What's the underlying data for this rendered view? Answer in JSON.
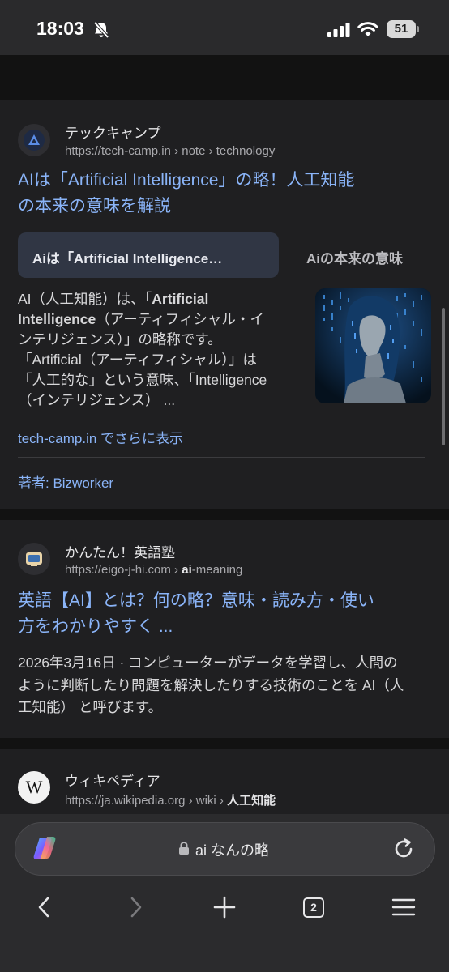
{
  "status": {
    "time": "18:03",
    "battery": "51"
  },
  "results": [
    {
      "site_name": "テックキャンプ",
      "url_base": "https://tech-camp.in",
      "url_path": " › note › technology",
      "title_line1": "AIは「Artificial Intelligence」の略！人工知能",
      "title_line2": "の本来の意味を解説",
      "chips": [
        "Aiは「Artificial Intelligence…",
        "Aiの本来の意味"
      ],
      "snippet": {
        "l1_a": "AI（人工知能）は、「",
        "l1_b": "Artificial",
        "l2_a": "Intelligence",
        "l2_b": "（アーティフィシャル・イ",
        "l3": "ンテリジェンス）」の略称です。",
        "l4": "「Artificial（アーティフィシャル）」は",
        "l5": "「人工的な」という意味、「Intelligence",
        "l6": "（インテリジェンス） ..."
      },
      "more": "tech-camp.in でさらに表示",
      "author": "著者: Bizworker"
    },
    {
      "site_name": "かんたん！英語塾",
      "url_base": "https://eigo-j-hi.com",
      "url_sep": " › ",
      "url_bold": "ai",
      "url_rest": "-meaning",
      "title_line1": "英語【AI】とは？何の略？意味・読み方・使い",
      "title_line2": "方をわかりやすく ...",
      "snippet": {
        "l1": "2026年3月16日 · コンピューターがデータを学習し、人間の",
        "l2": "ように判断したり問題を解決したりする技術のことを AI（人",
        "l3": "工知能） と呼びます。"
      }
    },
    {
      "site_name": "ウィキペディア",
      "url_base": "https://ja.wikipedia.org",
      "url_path": " › wiki › ",
      "url_bold": "人工知能"
    }
  ],
  "address_bar": {
    "query": "ai なんの略"
  },
  "toolbar": {
    "tab_count": "2"
  },
  "icons": {
    "bell_off": "bell-slash-icon",
    "copilot": "copilot-icon",
    "lock": "lock-icon",
    "reload": "reload-icon"
  },
  "colors": {
    "link": "#8ab4f8",
    "background": "#1f1f21",
    "separator": "#121212"
  }
}
